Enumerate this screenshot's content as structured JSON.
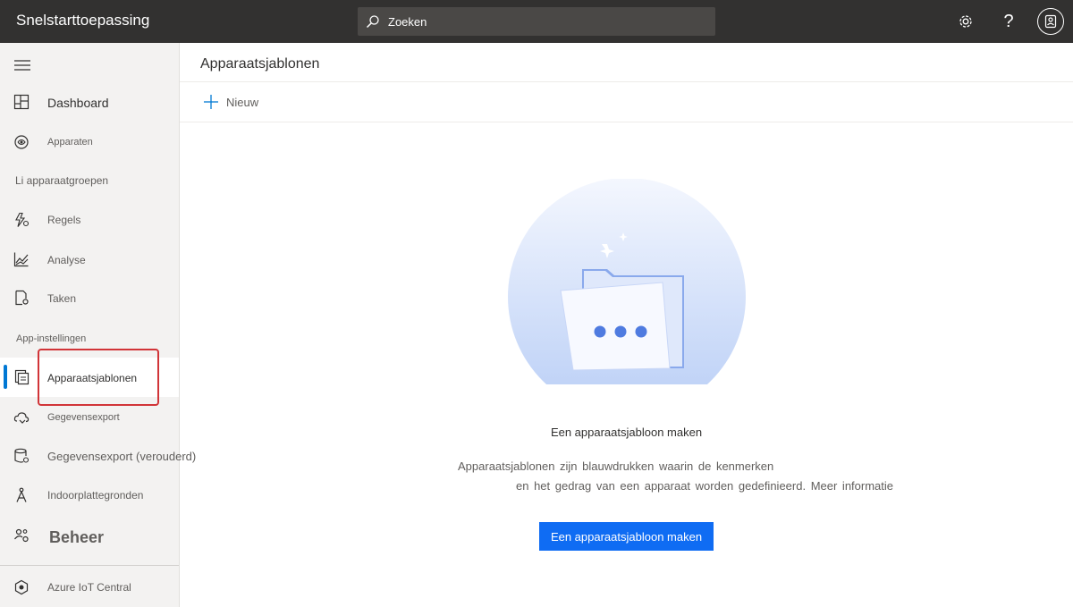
{
  "header": {
    "app_title": "Snelstarttoepassing",
    "search_placeholder": "Zoeken",
    "settings_icon": "gear-icon",
    "help_label": "?",
    "account_icon": "account-icon"
  },
  "sidebar": {
    "menu_icon": "hamburger-icon",
    "items": {
      "dashboard": "Dashboard",
      "devices": "Apparaten",
      "device_groups": "Li apparaatgroepen",
      "rules": "Regels",
      "analytics": "Analyse",
      "jobs": "Taken",
      "app_settings_header": "App-instellingen",
      "device_templates": "Apparaatsjablonen",
      "data_export": "Gegevensexport",
      "data_export_legacy": "Gegevensexport  (verouderd)",
      "floor_plans": "Indoorplattegronden",
      "admin": "Beheer",
      "iot_central": "Azure IoT Central"
    },
    "active_item": "Apparaatsjablonen"
  },
  "main": {
    "title": "Apparaatsjablonen",
    "new_button": "Nieuw",
    "empty_state": {
      "title": "Een apparaatsjabloon maken",
      "description_line1": "Apparaatsjablonen zijn blauwdrukken waarin de kenmerken",
      "description_line2": "en het gedrag van een apparaat worden gedefinieerd.",
      "learn_more": "Meer informatie",
      "create_button": "Een apparaatsjabloon maken"
    }
  },
  "colors": {
    "topbar": "#323130",
    "sidebar": "#f3f2f1",
    "accent": "#0078d4",
    "primary_button": "#0f6cf3",
    "highlight": "#d13438"
  }
}
